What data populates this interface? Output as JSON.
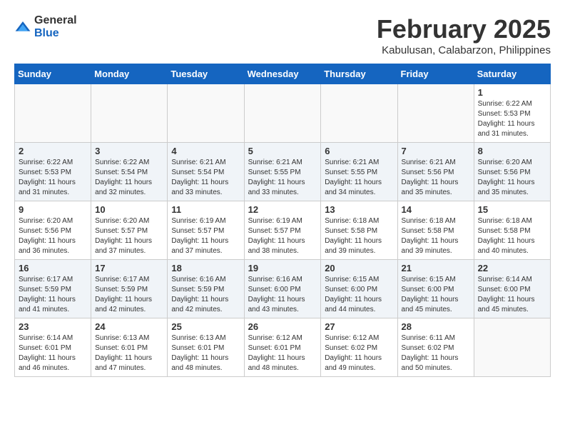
{
  "logo": {
    "general": "General",
    "blue": "Blue"
  },
  "title": {
    "month_year": "February 2025",
    "location": "Kabulusan, Calabarzon, Philippines"
  },
  "weekdays": [
    "Sunday",
    "Monday",
    "Tuesday",
    "Wednesday",
    "Thursday",
    "Friday",
    "Saturday"
  ],
  "weeks": [
    [
      {
        "day": "",
        "info": ""
      },
      {
        "day": "",
        "info": ""
      },
      {
        "day": "",
        "info": ""
      },
      {
        "day": "",
        "info": ""
      },
      {
        "day": "",
        "info": ""
      },
      {
        "day": "",
        "info": ""
      },
      {
        "day": "1",
        "info": "Sunrise: 6:22 AM\nSunset: 5:53 PM\nDaylight: 11 hours and 31 minutes."
      }
    ],
    [
      {
        "day": "2",
        "info": "Sunrise: 6:22 AM\nSunset: 5:53 PM\nDaylight: 11 hours and 31 minutes."
      },
      {
        "day": "3",
        "info": "Sunrise: 6:22 AM\nSunset: 5:54 PM\nDaylight: 11 hours and 32 minutes."
      },
      {
        "day": "4",
        "info": "Sunrise: 6:21 AM\nSunset: 5:54 PM\nDaylight: 11 hours and 33 minutes."
      },
      {
        "day": "5",
        "info": "Sunrise: 6:21 AM\nSunset: 5:55 PM\nDaylight: 11 hours and 33 minutes."
      },
      {
        "day": "6",
        "info": "Sunrise: 6:21 AM\nSunset: 5:55 PM\nDaylight: 11 hours and 34 minutes."
      },
      {
        "day": "7",
        "info": "Sunrise: 6:21 AM\nSunset: 5:56 PM\nDaylight: 11 hours and 35 minutes."
      },
      {
        "day": "8",
        "info": "Sunrise: 6:20 AM\nSunset: 5:56 PM\nDaylight: 11 hours and 35 minutes."
      }
    ],
    [
      {
        "day": "9",
        "info": "Sunrise: 6:20 AM\nSunset: 5:56 PM\nDaylight: 11 hours and 36 minutes."
      },
      {
        "day": "10",
        "info": "Sunrise: 6:20 AM\nSunset: 5:57 PM\nDaylight: 11 hours and 37 minutes."
      },
      {
        "day": "11",
        "info": "Sunrise: 6:19 AM\nSunset: 5:57 PM\nDaylight: 11 hours and 37 minutes."
      },
      {
        "day": "12",
        "info": "Sunrise: 6:19 AM\nSunset: 5:57 PM\nDaylight: 11 hours and 38 minutes."
      },
      {
        "day": "13",
        "info": "Sunrise: 6:18 AM\nSunset: 5:58 PM\nDaylight: 11 hours and 39 minutes."
      },
      {
        "day": "14",
        "info": "Sunrise: 6:18 AM\nSunset: 5:58 PM\nDaylight: 11 hours and 39 minutes."
      },
      {
        "day": "15",
        "info": "Sunrise: 6:18 AM\nSunset: 5:58 PM\nDaylight: 11 hours and 40 minutes."
      }
    ],
    [
      {
        "day": "16",
        "info": "Sunrise: 6:17 AM\nSunset: 5:59 PM\nDaylight: 11 hours and 41 minutes."
      },
      {
        "day": "17",
        "info": "Sunrise: 6:17 AM\nSunset: 5:59 PM\nDaylight: 11 hours and 42 minutes."
      },
      {
        "day": "18",
        "info": "Sunrise: 6:16 AM\nSunset: 5:59 PM\nDaylight: 11 hours and 42 minutes."
      },
      {
        "day": "19",
        "info": "Sunrise: 6:16 AM\nSunset: 6:00 PM\nDaylight: 11 hours and 43 minutes."
      },
      {
        "day": "20",
        "info": "Sunrise: 6:15 AM\nSunset: 6:00 PM\nDaylight: 11 hours and 44 minutes."
      },
      {
        "day": "21",
        "info": "Sunrise: 6:15 AM\nSunset: 6:00 PM\nDaylight: 11 hours and 45 minutes."
      },
      {
        "day": "22",
        "info": "Sunrise: 6:14 AM\nSunset: 6:00 PM\nDaylight: 11 hours and 45 minutes."
      }
    ],
    [
      {
        "day": "23",
        "info": "Sunrise: 6:14 AM\nSunset: 6:01 PM\nDaylight: 11 hours and 46 minutes."
      },
      {
        "day": "24",
        "info": "Sunrise: 6:13 AM\nSunset: 6:01 PM\nDaylight: 11 hours and 47 minutes."
      },
      {
        "day": "25",
        "info": "Sunrise: 6:13 AM\nSunset: 6:01 PM\nDaylight: 11 hours and 48 minutes."
      },
      {
        "day": "26",
        "info": "Sunrise: 6:12 AM\nSunset: 6:01 PM\nDaylight: 11 hours and 48 minutes."
      },
      {
        "day": "27",
        "info": "Sunrise: 6:12 AM\nSunset: 6:02 PM\nDaylight: 11 hours and 49 minutes."
      },
      {
        "day": "28",
        "info": "Sunrise: 6:11 AM\nSunset: 6:02 PM\nDaylight: 11 hours and 50 minutes."
      },
      {
        "day": "",
        "info": ""
      }
    ]
  ]
}
